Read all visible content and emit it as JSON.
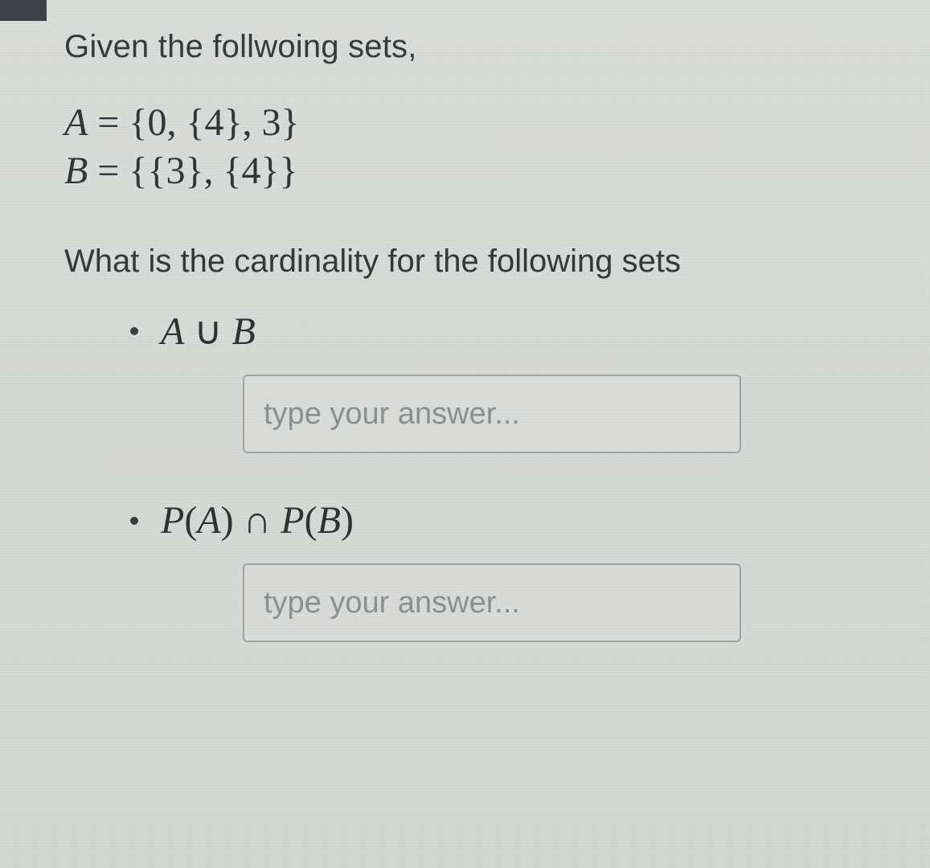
{
  "question": {
    "intro": "Given the follwoing sets,",
    "set_a": "A = {0, {4}, 3}",
    "set_b": "B = {{3}, {4}}",
    "subprompt": "What is the cardinality for the following sets",
    "items": [
      {
        "expr_plain": "A ∪ B",
        "placeholder": "type your answer...",
        "value": ""
      },
      {
        "expr_plain": "P(A) ∩ P(B)",
        "placeholder": "type your answer...",
        "value": ""
      }
    ]
  }
}
